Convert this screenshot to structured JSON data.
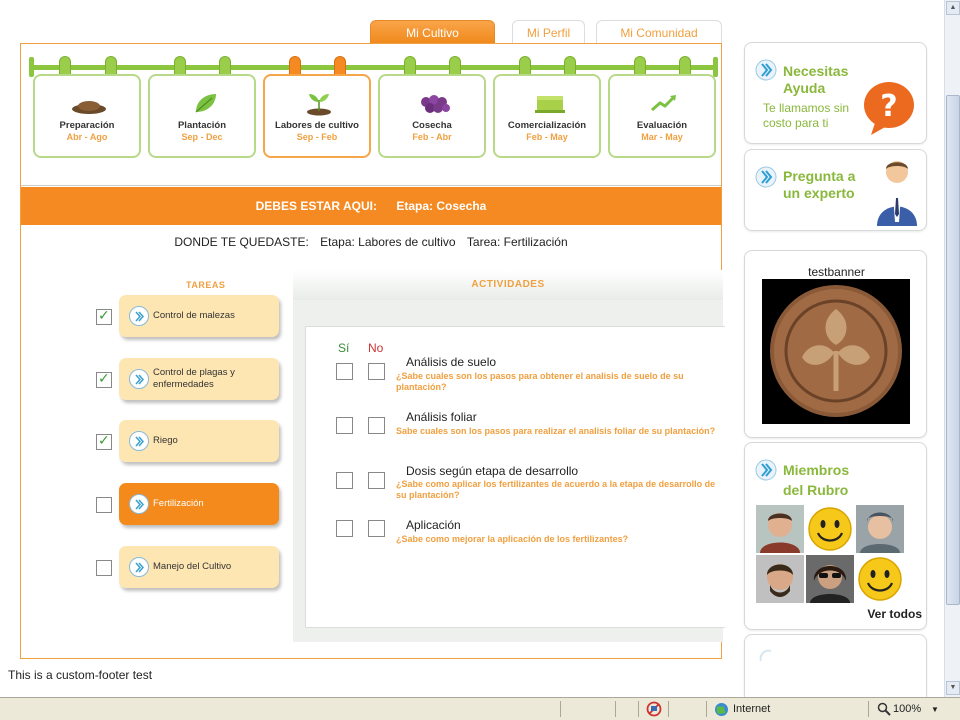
{
  "tabs": [
    {
      "label": "Mi Cultivo",
      "active": true
    },
    {
      "label": "Mi Perfil",
      "active": false
    },
    {
      "label": "Mi Comunidad",
      "active": false
    }
  ],
  "stages": [
    {
      "name": "Preparación",
      "dates": "Abr - Ago",
      "icon": "soil-mound-icon"
    },
    {
      "name": "Plantación",
      "dates": "Sep - Dec",
      "icon": "leaf-icon"
    },
    {
      "name": "Labores de cultivo",
      "dates": "Sep - Feb",
      "icon": "seedling-icon",
      "current": true
    },
    {
      "name": "Cosecha",
      "dates": "Feb - Abr",
      "icon": "grapes-icon"
    },
    {
      "name": "Comercialización",
      "dates": "Feb - May",
      "icon": "crate-icon"
    },
    {
      "name": "Evaluación",
      "dates": "Mar - May",
      "icon": "growth-chart-icon"
    }
  ],
  "here": {
    "label": "DEBES ESTAR AQUI:",
    "value": "Etapa: Cosecha"
  },
  "where": {
    "label": "DONDE TE QUEDASTE:",
    "stage": "Etapa: Labores de cultivo",
    "task": "Tarea: Fertilización"
  },
  "tasks": {
    "title": "TAREAS",
    "items": [
      {
        "label": "Control de malezas",
        "checked": true,
        "active": false
      },
      {
        "label": "Control de plagas y enfermedades",
        "checked": true,
        "active": false
      },
      {
        "label": "Riego",
        "checked": true,
        "active": false
      },
      {
        "label": "Fertilización",
        "checked": false,
        "active": true
      },
      {
        "label": "Manejo del Cultivo",
        "checked": false,
        "active": false
      }
    ]
  },
  "activities": {
    "title": "ACTIVIDADES",
    "yes_label": "Sí",
    "no_label": "No",
    "items": [
      {
        "title": "Análisis de suelo",
        "question": "¿Sabe cuales son los pasos para obtener el analisis de suelo de su plantación?"
      },
      {
        "title": "Análisis foliar",
        "question": "Sabe cuales son los pasos para realizar el analisis foliar de su plantación?"
      },
      {
        "title": "Dosis según etapa de desarrollo",
        "question": "¿Sabe como aplicar los fertilizantes de acuerdo a la etapa de desarrollo de su plantación?"
      },
      {
        "title": "Aplicación",
        "question": "¿Sabe como mejorar la aplicación de los fertilizantes?"
      }
    ]
  },
  "sidebar": {
    "help": {
      "title_line1": "Necesitas",
      "title_line2": "Ayuda",
      "sub_line1": "Te llamamos sin",
      "sub_line2": "costo para ti"
    },
    "expert": {
      "title_line1": "Pregunta a",
      "title_line2": "un experto"
    },
    "banner": {
      "title": "testbanner"
    },
    "members": {
      "title_line1": "Miembros",
      "title_line2": "del Rubro",
      "view_all": "Ver todos"
    }
  },
  "footer_text": "This is a custom-footer test",
  "statusbar": {
    "zone": "Internet",
    "zoom": "100%"
  },
  "colors": {
    "orange": "#f58a23",
    "green": "#8cc63f",
    "light_orange": "#fde6b2"
  }
}
